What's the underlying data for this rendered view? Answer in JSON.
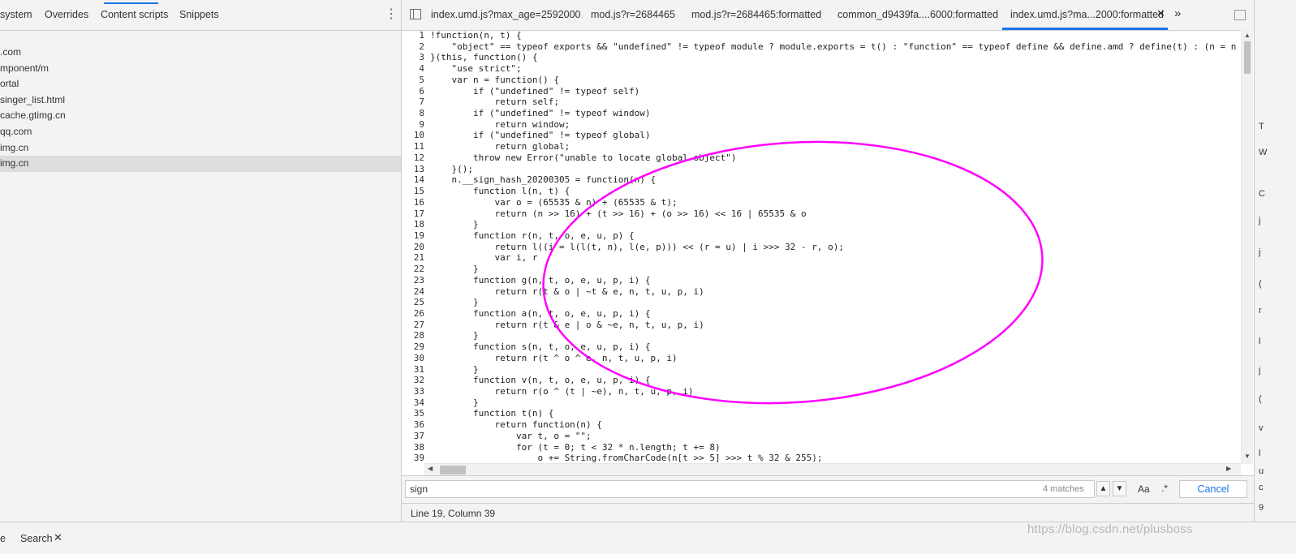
{
  "sidebar": {
    "tabs": [
      "system",
      "Overrides",
      "Content scripts",
      "Snippets"
    ],
    "tree_items": [
      ".com",
      "mponent/m",
      "ortal",
      "singer_list.html",
      "cache.gtimg.cn",
      "qq.com",
      "img.cn",
      "img.cn"
    ]
  },
  "editor": {
    "file_tabs": [
      "index.umd.js?max_age=2592000",
      "mod.js?r=2684465",
      "mod.js?r=2684465:formatted",
      "common_d9439fa....6000:formatted",
      "index.umd.js?ma...2000:formatted"
    ],
    "active_tab_index": 4,
    "code_lines": [
      "!function(n, t) {",
      "    \"object\" == typeof exports && \"undefined\" != typeof module ? module.exports = t() : \"function\" == typeof define && define.amd ? define(t) : (n = n ||",
      "}(this, function() {",
      "    \"use strict\";",
      "    var n = function() {",
      "        if (\"undefined\" != typeof self)",
      "            return self;",
      "        if (\"undefined\" != typeof window)",
      "            return window;",
      "        if (\"undefined\" != typeof global)",
      "            return global;",
      "        throw new Error(\"unable to locate global object\")",
      "    }();",
      "    n.__sign_hash_20200305 = function(n) {",
      "        function l(n, t) {",
      "            var o = (65535 & n) + (65535 & t);",
      "            return (n >> 16) + (t >> 16) + (o >> 16) << 16 | 65535 & o",
      "        }",
      "        function r(n, t, o, e, u, p) {",
      "            return l((i = l(l(t, n), l(e, p))) << (r = u) | i >>> 32 - r, o);",
      "            var i, r",
      "        }",
      "        function g(n, t, o, e, u, p, i) {",
      "            return r(t & o | ~t & e, n, t, u, p, i)",
      "        }",
      "        function a(n, t, o, e, u, p, i) {",
      "            return r(t & e | o & ~e, n, t, u, p, i)",
      "        }",
      "        function s(n, t, o, e, u, p, i) {",
      "            return r(t ^ o ^ e, n, t, u, p, i)",
      "        }",
      "        function v(n, t, o, e, u, p, i) {",
      "            return r(o ^ (t | ~e), n, t, u, p, i)",
      "        }",
      "        function t(n) {",
      "            return function(n) {",
      "                var t, o = \"\";",
      "                for (t = 0; t < 32 * n.length; t += 8)",
      "                    o += String.fromCharCode(n[t >> 5] >>> t % 32 & 255);",
      "                "
    ]
  },
  "search": {
    "query": "sign",
    "match_count": "4 matches",
    "case_label": "Aa",
    "regex_label": ".*",
    "cancel_label": "Cancel"
  },
  "status": {
    "position": "Line 19, Column 39"
  },
  "right_panel": {
    "items": [
      "T",
      "W",
      "C",
      "j",
      "j",
      "(",
      "r",
      "l",
      "j",
      "(",
      "v",
      "l",
      "u",
      "c",
      "9"
    ]
  },
  "drawer": {
    "tab_partial": "e",
    "tab": "Search",
    "close": "✕"
  },
  "watermark": "https://blog.csdn.net/plusboss",
  "colors": {
    "accent": "#1a73e8",
    "annotation": "#ff00ff"
  }
}
